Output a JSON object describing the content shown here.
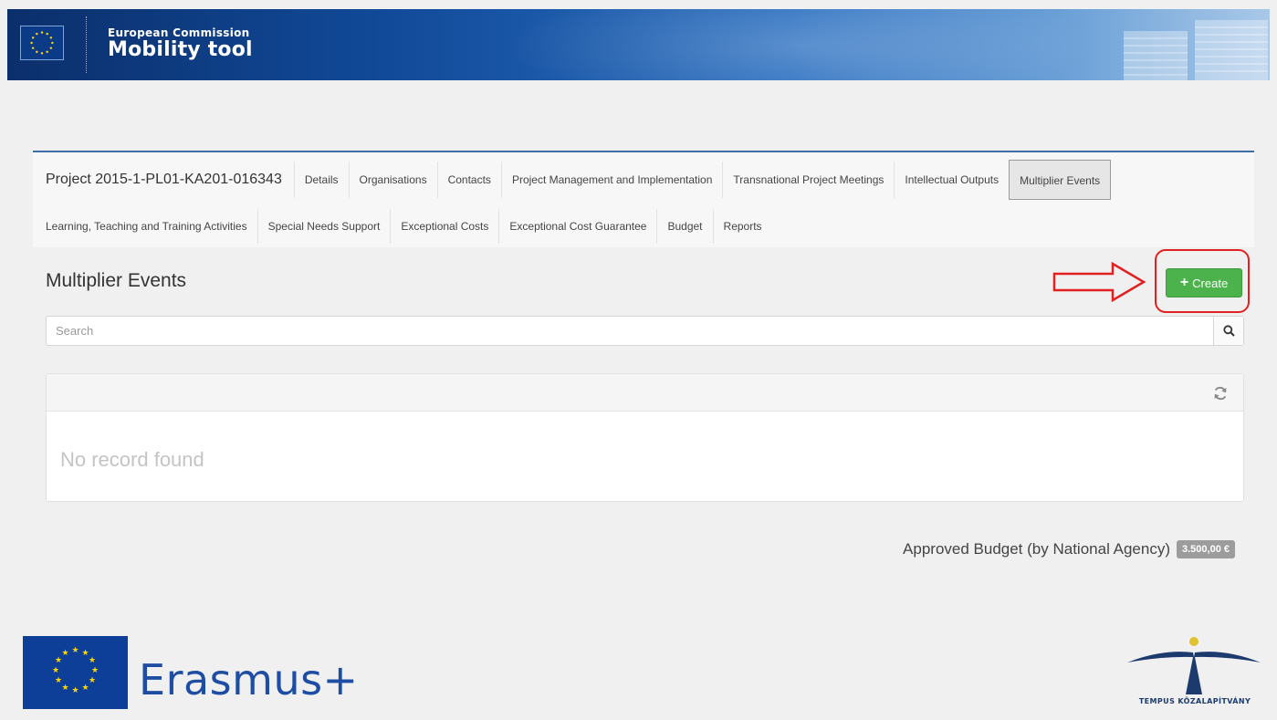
{
  "header": {
    "org_name": "European Commission",
    "app_name": "Mobility tool"
  },
  "nav": {
    "project_title": "Project 2015-1-PL01-KA201-016343",
    "tabs_row1": [
      {
        "label": "Details"
      },
      {
        "label": "Organisations"
      },
      {
        "label": "Contacts"
      },
      {
        "label": "Project Management and Implementation"
      },
      {
        "label": "Transnational Project Meetings"
      },
      {
        "label": "Intellectual Outputs"
      },
      {
        "label": "Multiplier Events",
        "active": true
      }
    ],
    "tabs_row2": [
      {
        "label": "Learning, Teaching and Training Activities"
      },
      {
        "label": "Special Needs Support"
      },
      {
        "label": "Exceptional Costs"
      },
      {
        "label": "Exceptional Cost Guarantee"
      },
      {
        "label": "Budget"
      },
      {
        "label": "Reports"
      }
    ]
  },
  "main": {
    "page_title": "Multiplier Events",
    "create_label": "Create",
    "search_placeholder": "Search",
    "empty_message": "No record found"
  },
  "budget": {
    "label": "Approved Budget (by National Agency)",
    "value": "3.500,00 €"
  },
  "footer": {
    "erasmus_label": "Erasmus+",
    "tempus_label": "TEMPUS KÖZALAPÍTVÁNY"
  },
  "colors": {
    "create_button": "#4cb24c",
    "annotation_red": "#e22020",
    "banner_blue": "#114a99",
    "erasmus_blue": "#1e4ea3"
  },
  "icons": [
    "eu-flag-icon",
    "search-icon",
    "refresh-icon",
    "plus-icon",
    "arrow-right-annotation",
    "erasmus-flag-icon",
    "tempus-logo-icon"
  ]
}
